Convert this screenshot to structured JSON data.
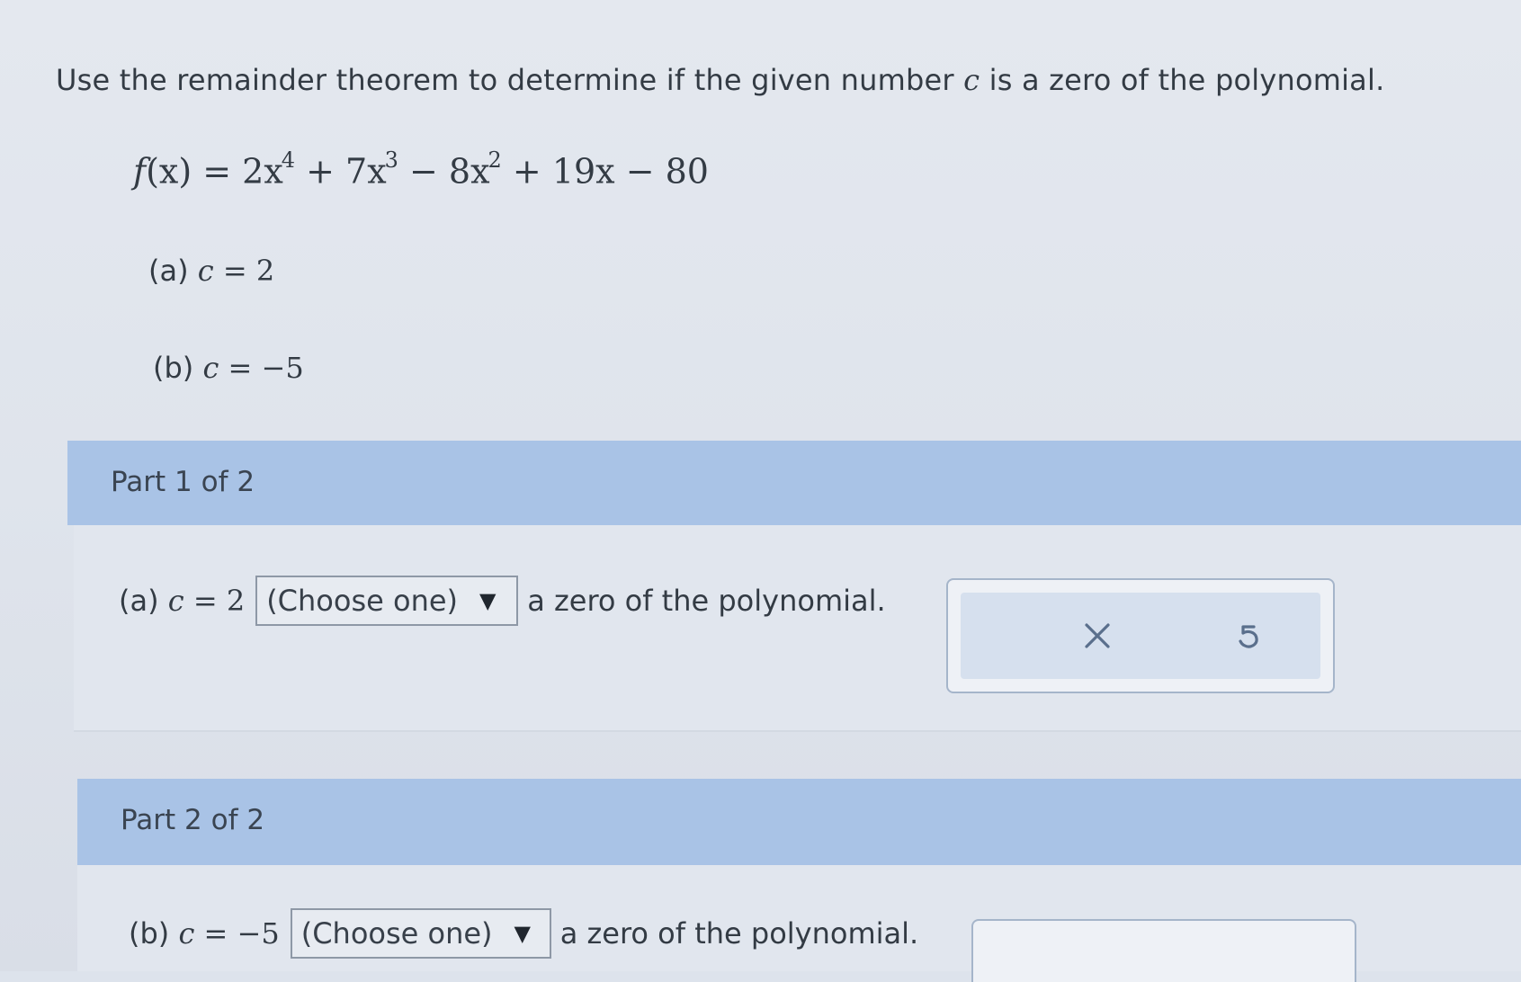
{
  "prompt": {
    "before": "Use the remainder theorem to determine if the given number ",
    "var": "c",
    "after": " is a zero of the polynomial."
  },
  "equation": {
    "fname": "f",
    "lhs_rest": "(x) = 2x",
    "exp1": "4",
    "t2": " + 7x",
    "exp2": "3",
    "t3": " − 8x",
    "exp3": "2",
    "t4": " + 19x − 80"
  },
  "items": {
    "a": {
      "label": "(a) ",
      "var": "c",
      "eq": " = ",
      "value": "2"
    },
    "b": {
      "label": "(b) ",
      "var": "c",
      "eq": " = ",
      "value": "−5"
    }
  },
  "part1": {
    "title": "Part 1 of 2",
    "label": "(a) ",
    "var": "c",
    "eq": " = ",
    "value": "2",
    "select_value": "(Choose one)",
    "suffix": "a zero of the polynomial."
  },
  "part2": {
    "title": "Part 2 of 2",
    "label": "(b) ",
    "var": "c",
    "eq": " = ",
    "value": "−5",
    "select_value": "(Choose one)",
    "suffix": "a zero of the polynomial."
  },
  "icons": {
    "caret": "▼",
    "clear": "x-icon",
    "undo": "undo-icon"
  }
}
